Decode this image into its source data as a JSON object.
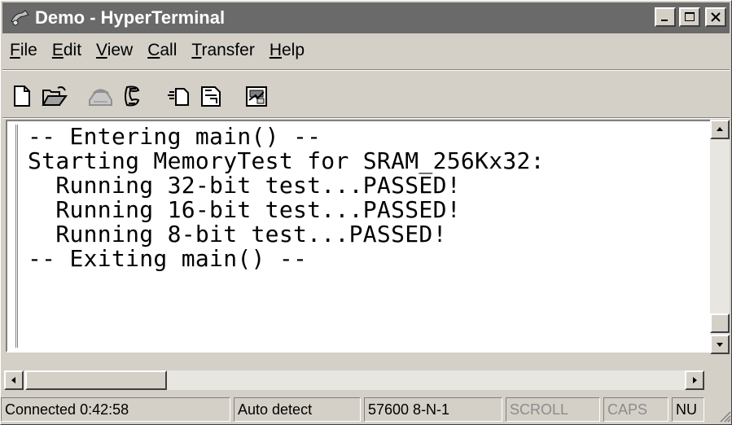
{
  "window": {
    "title": "Demo - HyperTerminal",
    "min_label": "_",
    "max_label": "□",
    "close_label": "×"
  },
  "menu": {
    "items": [
      {
        "accel": "F",
        "rest": "ile"
      },
      {
        "accel": "E",
        "rest": "dit"
      },
      {
        "accel": "V",
        "rest": "iew"
      },
      {
        "accel": "C",
        "rest": "all"
      },
      {
        "accel": "T",
        "rest": "ransfer"
      },
      {
        "accel": "H",
        "rest": "elp"
      }
    ]
  },
  "toolbar": {
    "buttons": [
      "new-file-icon",
      "open-folder-icon",
      "connect-phone-icon",
      "disconnect-phone-icon",
      "send-file-icon",
      "receive-file-icon",
      "properties-icon"
    ]
  },
  "terminal": {
    "lines": [
      "-- Entering main() --",
      "Starting MemoryTest for SRAM_256Kx32:",
      "  Running 32-bit test...PASSED!",
      "  Running 16-bit test...PASSED!",
      "  Running 8-bit test...PASSED!",
      "-- Exiting main() --"
    ]
  },
  "status": {
    "connected": "Connected 0:42:58",
    "detect": "Auto detect",
    "port": "57600 8-N-1",
    "scroll": "SCROLL",
    "caps": "CAPS",
    "num": "NU"
  },
  "colors": {
    "titlebar": "#6a6a6a",
    "face": "#d4d0c8",
    "terminal_bg": "#ffffff"
  }
}
